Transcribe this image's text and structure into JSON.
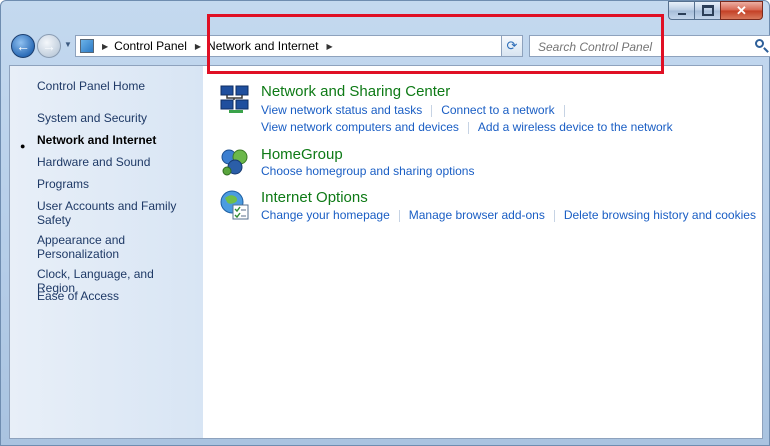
{
  "window": {
    "caption": {
      "minimize": "minimize",
      "maximize": "maximize",
      "close": "close"
    }
  },
  "navbar": {
    "breadcrumbs": [
      "Control Panel",
      "Network and Internet"
    ],
    "search_placeholder": "Search Control Panel"
  },
  "sidebar": {
    "home": "Control Panel Home",
    "items": [
      {
        "label": "System and Security"
      },
      {
        "label": "Network and Internet",
        "current": true
      },
      {
        "label": "Hardware and Sound"
      },
      {
        "label": "Programs"
      },
      {
        "label": "User Accounts and Family Safety"
      },
      {
        "label": "Appearance and Personalization"
      },
      {
        "label": "Clock, Language, and Region"
      },
      {
        "label": "Ease of Access"
      }
    ]
  },
  "categories": [
    {
      "title": "Network and Sharing Center",
      "icon": "network-sharing-icon",
      "links_row1": [
        "View network status and tasks",
        "Connect to a network"
      ],
      "links_row2": [
        "View network computers and devices",
        "Add a wireless device to the network"
      ]
    },
    {
      "title": "HomeGroup",
      "icon": "homegroup-icon",
      "links_row1": [
        "Choose homegroup and sharing options"
      ]
    },
    {
      "title": "Internet Options",
      "icon": "internet-options-icon",
      "links_row1": [
        "Change your homepage",
        "Manage browser add-ons",
        "Delete browsing history and cookies"
      ]
    }
  ],
  "colors": {
    "category_title": "#0e7a16",
    "link": "#1a5ec4",
    "highlight": "#e01025"
  }
}
